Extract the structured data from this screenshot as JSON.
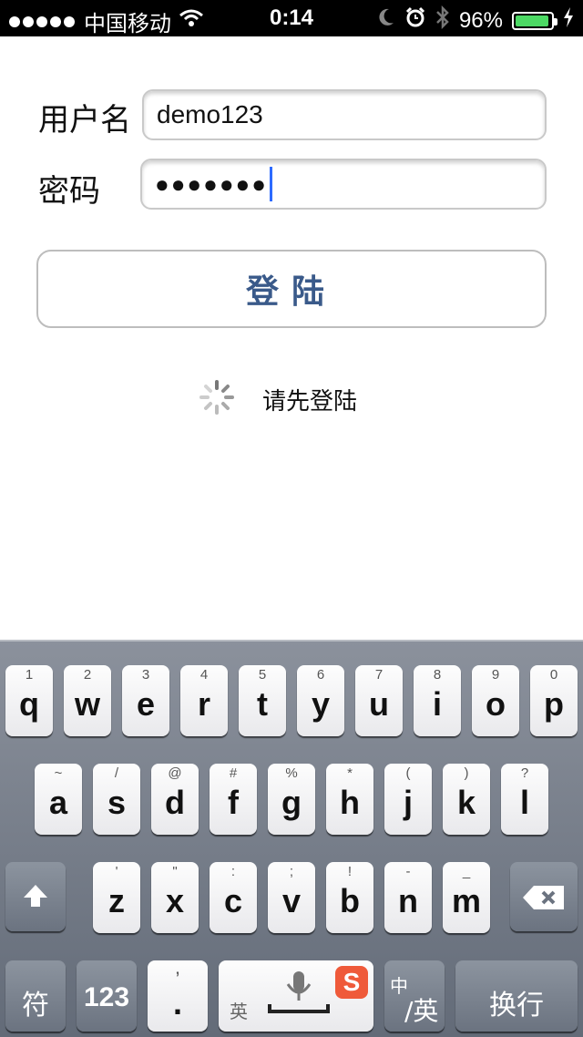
{
  "status_bar": {
    "carrier": "中国移动",
    "time": "0:14",
    "battery_percent": "96%",
    "battery_level": 0.96
  },
  "form": {
    "username_label": "用户名",
    "username_value": "demo123",
    "password_label": "密码",
    "password_masked": "●●●●●●●",
    "login_button": "登陆",
    "status_message": "请先登陆"
  },
  "keyboard": {
    "row1": [
      {
        "main": "q",
        "sub": "1"
      },
      {
        "main": "w",
        "sub": "2"
      },
      {
        "main": "e",
        "sub": "3"
      },
      {
        "main": "r",
        "sub": "4"
      },
      {
        "main": "t",
        "sub": "5"
      },
      {
        "main": "y",
        "sub": "6"
      },
      {
        "main": "u",
        "sub": "7"
      },
      {
        "main": "i",
        "sub": "8"
      },
      {
        "main": "o",
        "sub": "9"
      },
      {
        "main": "p",
        "sub": "0"
      }
    ],
    "row2": [
      {
        "main": "a",
        "sub": "~"
      },
      {
        "main": "s",
        "sub": "/"
      },
      {
        "main": "d",
        "sub": "@"
      },
      {
        "main": "f",
        "sub": "#"
      },
      {
        "main": "g",
        "sub": "%"
      },
      {
        "main": "h",
        "sub": "*"
      },
      {
        "main": "j",
        "sub": "("
      },
      {
        "main": "k",
        "sub": ")"
      },
      {
        "main": "l",
        "sub": "?"
      }
    ],
    "row3": [
      {
        "main": "z",
        "sub": "'"
      },
      {
        "main": "x",
        "sub": "\""
      },
      {
        "main": "c",
        "sub": ":"
      },
      {
        "main": "v",
        "sub": ";"
      },
      {
        "main": "b",
        "sub": "!"
      },
      {
        "main": "n",
        "sub": "-"
      },
      {
        "main": "m",
        "sub": "_"
      }
    ],
    "symbols_key": "符",
    "numbers_key": "123",
    "punct_main": ".",
    "punct_sub": "’",
    "space_label": "英",
    "lang_switch_top": "中",
    "lang_switch_bottom": "/英",
    "return_key": "换行"
  }
}
